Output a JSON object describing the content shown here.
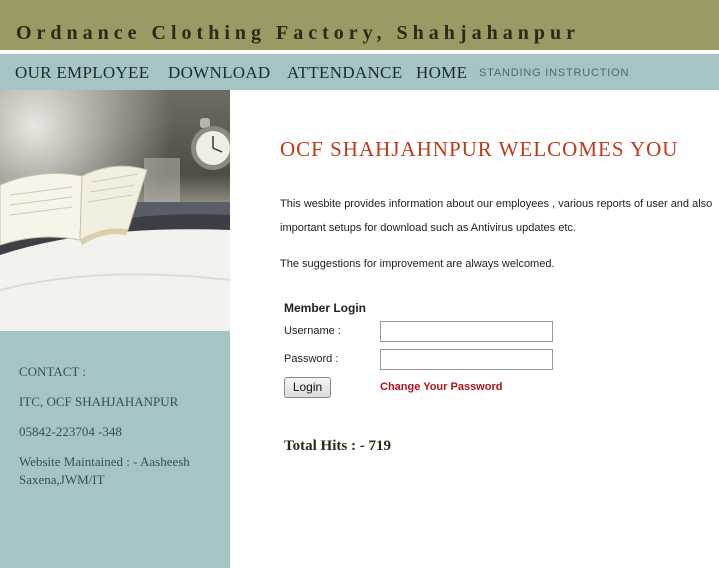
{
  "header": {
    "title": "Ordnance Clothing Factory, Shahjahanpur"
  },
  "nav": {
    "items": [
      {
        "label": "OUR EMPLOYEE"
      },
      {
        "label": "DOWNLOAD"
      },
      {
        "label": "ATTENDANCE"
      },
      {
        "label": "HOME"
      }
    ],
    "small_item": "STANDING INSTRUCTION"
  },
  "sidebar": {
    "contact_label": "CONTACT :",
    "org": "ITC, OCF SHAHJAHANPUR",
    "phone": "05842-223704 -348",
    "maintained": "Website Maintained : - Aasheesh Saxena,JWM/IT"
  },
  "main": {
    "welcome": "OCF SHAHJAHNPUR WELCOMES YOU",
    "para1": "This wesbite provides information about our employees , various reports of user and also important setups for download such as Antivirus updates etc.",
    "para2": "The suggestions for improvement are always welcomed."
  },
  "login": {
    "title": "Member Login",
    "username_label": "Username :",
    "username_value": "",
    "password_label": "Password :",
    "password_value": "",
    "button_label": "Login",
    "change_password": "Change Your Password"
  },
  "hits": "Total Hits : - 719",
  "colors": {
    "header_bg": "#9a9a64",
    "nav_bg": "#a4c4c6",
    "welcome": "#c0391b",
    "link": "#b2121a"
  },
  "icons": [
    "open-book-image",
    "alarm-clock-image"
  ]
}
